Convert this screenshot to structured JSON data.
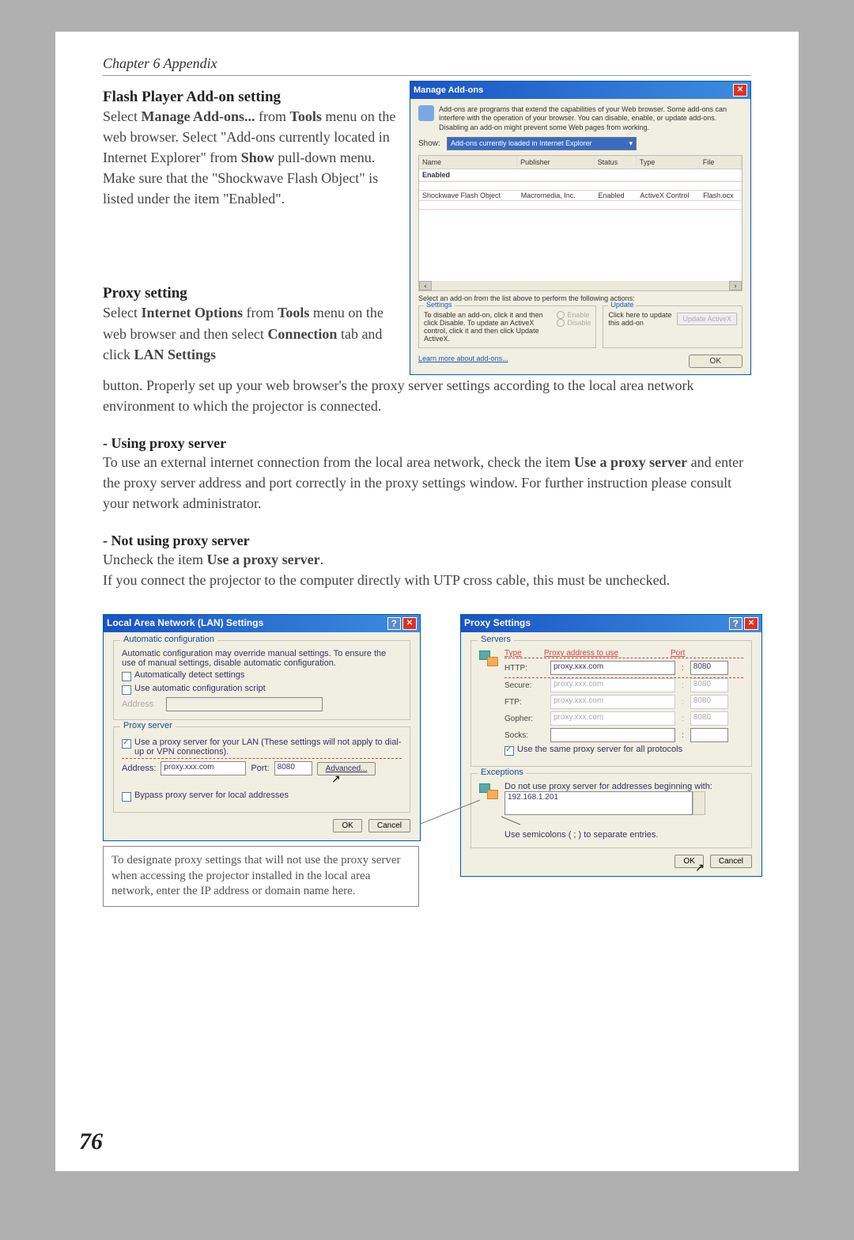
{
  "chapter": "Chapter 6 Appendix",
  "page_number": "76",
  "flash": {
    "title": "Flash Player Add-on setting",
    "body_pre": "Select ",
    "b1": "Manage Add-ons...",
    "body_mid1": " from ",
    "b2": "Tools",
    "body_mid2": " menu on the web browser. Select \"Add-ons currently located in Internet Explorer\" from ",
    "b3": "Show",
    "body_end": " pull-down menu. Make sure that the \"Shockwave Flash Object\" is listed under the item \"Enabled\"."
  },
  "proxy": {
    "title": "Proxy setting",
    "pre": "Select ",
    "b1": "Internet Options",
    "mid1": " from ",
    "b2": "Tools",
    "mid2": " menu on the web browser and then select ",
    "b3": "Connection",
    "mid3": " tab and click ",
    "b4": "LAN Settings",
    "end": " button. Properly set up your web browser's the proxy server settings according to the local area network environment to which the projector is connected."
  },
  "using": {
    "title": "- Using proxy server",
    "pre": "To use an external internet connection from the local area network, check the item ",
    "b1": "Use a proxy server",
    "end": " and enter the proxy server address and port correctly in the proxy settings window. For further instruction please consult your network administrator."
  },
  "notusing": {
    "title": "- Not using proxy server",
    "line1_pre": "Uncheck the item ",
    "b1": "Use a proxy server",
    "line1_end": ".",
    "line2": "If you connect the projector to the computer directly with UTP cross cable, this must be unchecked."
  },
  "addon_dialog": {
    "title": "Manage Add-ons",
    "desc": "Add-ons are programs that extend the capabilities of your Web browser. Some add-ons can interfere with the operation of your browser. You can disable, enable, or update add-ons. Disabling an add-on might prevent some Web pages from working.",
    "show_label": "Show:",
    "show_value": "Add-ons currently loaded in Internet Explorer",
    "cols": {
      "name": "Name",
      "publisher": "Publisher",
      "status": "Status",
      "type": "Type",
      "file": "File"
    },
    "enabled_group": "Enabled",
    "row": {
      "name": "Shockwave Flash Object",
      "publisher": "Macromedia, Inc.",
      "status": "Enabled",
      "type": "ActiveX Control",
      "file": "Flash.ocx"
    },
    "instr": "Select an add-on from the list above to perform the following actions:",
    "settings_label": "Settings",
    "settings_text": "To disable an add-on, click it and then click Disable. To update an ActiveX control, click it and then click Update ActiveX.",
    "enable": "Enable",
    "disable": "Disable",
    "update_label": "Update",
    "update_text": "Click here to update this add-on",
    "update_btn": "Update ActiveX",
    "learn": "Learn more about add-ons...",
    "ok": "OK"
  },
  "lan_dialog": {
    "title": "Local Area Network (LAN) Settings",
    "auto_label": "Automatic configuration",
    "auto_text": "Automatic configuration may override manual settings.  To ensure the use of manual settings, disable automatic configuration.",
    "auto_detect": "Automatically detect settings",
    "use_script": "Use automatic configuration script",
    "address_label": "Address",
    "proxy_label": "Proxy server",
    "use_proxy": "Use a proxy server for your LAN (These settings will not apply to dial-up or VPN connections).",
    "addr_label": "Address:",
    "addr_value": "proxy.xxx.com",
    "port_label": "Port:",
    "port_value": "8080",
    "advanced": "Advanced...",
    "bypass": "Bypass proxy server for local addresses",
    "ok": "OK",
    "cancel": "Cancel"
  },
  "proxy_dialog": {
    "title": "Proxy Settings",
    "servers_label": "Servers",
    "type_h": "Type",
    "addr_h": "Proxy address to use",
    "port_h": "Port",
    "rows": [
      {
        "label": "HTTP:",
        "addr": "proxy.xxx.com",
        "port": "8080",
        "active": true
      },
      {
        "label": "Secure:",
        "addr": "proxy.xxx.com",
        "port": "8080",
        "active": false
      },
      {
        "label": "FTP:",
        "addr": "proxy.xxx.com",
        "port": "8080",
        "active": false
      },
      {
        "label": "Gopher:",
        "addr": "proxy.xxx.com",
        "port": "8080",
        "active": false
      },
      {
        "label": "Socks:",
        "addr": "",
        "port": "",
        "active": true
      }
    ],
    "same_proxy": "Use the same proxy server for all protocols",
    "exceptions_label": "Exceptions",
    "exceptions_text": "Do not use proxy server for addresses beginning with:",
    "exceptions_value": "192.168.1.201",
    "semicolons": "Use semicolons ( ; ) to separate entries.",
    "ok": "OK",
    "cancel": "Cancel"
  },
  "caption": "To designate proxy settings that will not use the proxy server when accessing the projector installed in the local area network, enter the IP address or domain name here."
}
